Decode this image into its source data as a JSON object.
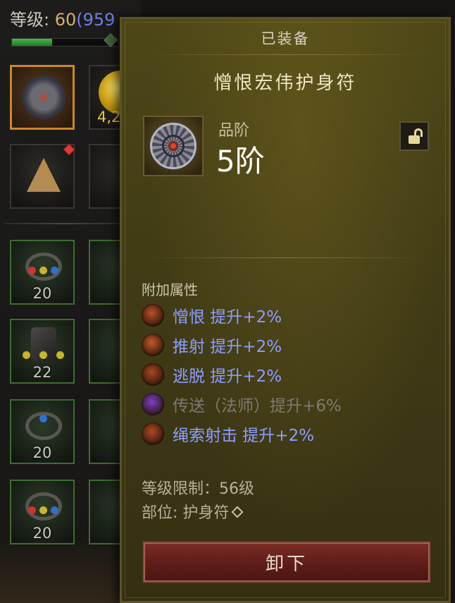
{
  "character": {
    "level_label": "等级: ",
    "level_value": "60",
    "paragon": "(959",
    "xp_progress": 0.38
  },
  "inventory": {
    "gold_amount": "4,2",
    "counts": [
      "20",
      "22",
      "20",
      "20"
    ]
  },
  "tooltip": {
    "header": "已装备",
    "item_name": "憎恨宏伟护身符",
    "grade_label": "品阶",
    "grade_value": "5阶",
    "affix_section_title": "附加属性",
    "affixes": [
      {
        "text": "憎恨  提升+2%",
        "active": true,
        "icon_color": "#b8502a"
      },
      {
        "text": "推射  提升+2%",
        "active": true,
        "icon_color": "#c25a2a"
      },
      {
        "text": "逃脱  提升+2%",
        "active": true,
        "icon_color": "#a8481f"
      },
      {
        "text": "传送（法师）提升+6%",
        "active": false,
        "icon_color": "#7b3fc4"
      },
      {
        "text": "绳索射击  提升+2%",
        "active": true,
        "icon_color": "#b04a24"
      }
    ],
    "level_requirement": "等级限制：56级",
    "slot": "部位: 护身符",
    "unequip_label": "卸下"
  },
  "colors": {
    "affix_active": "#8e9dff",
    "affix_inactive": "#7d7a72",
    "panel_bg": "#443e17",
    "legendary_border": "#c9872b"
  },
  "icons": {
    "lock": "unlock-icon",
    "amulet": "amulet-icon",
    "slot_marker": "diamond-gem-icon"
  }
}
